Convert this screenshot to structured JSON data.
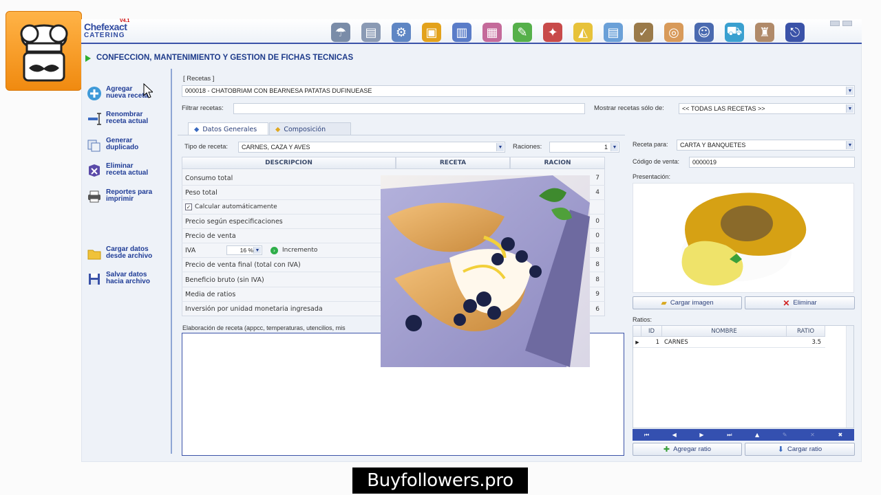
{
  "brand": {
    "line1": "Chefexact",
    "line2": "CATERING",
    "version": "V4.1"
  },
  "toolbar_icons": [
    "umbrella-icon",
    "register-icon",
    "gear-icon",
    "basket-icon",
    "folder-icon",
    "briefcase-icon",
    "pencils-icon",
    "map-icon",
    "cheese-icon",
    "document-icon",
    "checklist-icon",
    "ring-icon",
    "person-icon",
    "truck-icon",
    "bottle-icon",
    "exit-icon"
  ],
  "page_title": "CONFECCION, MANTENIMIENTO Y GESTION DE FICHAS TECNICAS",
  "sidebar": [
    {
      "label": "Agregar\nnueva receta",
      "icon": "add-icon"
    },
    {
      "label": "Renombrar\nreceta actual",
      "icon": "rename-icon"
    },
    {
      "label": "Generar\nduplicado",
      "icon": "duplicate-icon"
    },
    {
      "label": "Eliminar\nreceta actual",
      "icon": "delete-icon"
    },
    {
      "label": "Reportes para\nimprimir",
      "icon": "printer-icon"
    },
    {
      "label": "Cargar datos\ndesde archivo",
      "icon": "folder-open-icon"
    },
    {
      "label": "Salvar datos\nhacia archivo",
      "icon": "save-icon"
    }
  ],
  "recetas": {
    "group_label": "[ Recetas ]",
    "selected": "000018 - CHATOBRIAM CON BEARNESA PATATAS DUFINUEASE",
    "filter_label": "Filtrar recetas:",
    "filter_value": "",
    "show_label": "Mostrar recetas sólo de:",
    "show_value": "<< TODAS LAS RECETAS >>"
  },
  "tabs": [
    {
      "label": "Datos Generales",
      "active": true
    },
    {
      "label": "Composición",
      "active": false
    }
  ],
  "general": {
    "tipo_label": "Tipo de receta:",
    "tipo_value": "CARNES, CAZA Y AVES",
    "raciones_label": "Raciones:",
    "raciones_value": "1",
    "columns": [
      "DESCRIPCION",
      "RECETA",
      "RACION"
    ],
    "rows": [
      {
        "label": "Consumo total",
        "racion": "7"
      },
      {
        "label": "Peso total",
        "racion": "4"
      },
      {
        "label": "Calcular automáticamente",
        "racion": ""
      },
      {
        "label": "Precio según especificaciones",
        "racion": "0"
      },
      {
        "label": "Precio de venta",
        "racion": "0"
      },
      {
        "label": "IVA",
        "racion": "8"
      },
      {
        "label": "Precio de venta final (total con IVA)",
        "racion": "8"
      },
      {
        "label": "Beneficio bruto (sin IVA)",
        "racion": "8"
      },
      {
        "label": "Media de ratios",
        "racion": "9"
      },
      {
        "label": "Inversión por unidad monetaria ingresada",
        "racion": "6"
      }
    ],
    "iva_value": "16 %",
    "iva_increment": "Incremento",
    "elab_label": "Elaboración de receta (appcc, temperaturas, utencilios, mis"
  },
  "right": {
    "receta_para_label": "Receta para:",
    "receta_para_value": "CARTA Y BANQUETES",
    "codigo_label": "Código de venta:",
    "codigo_value": "0000019",
    "presentacion_label": "Presentación:",
    "cargar_imagen": "Cargar imagen",
    "eliminar": "Eliminar",
    "ratios_label": "Ratios:",
    "ratio_columns": [
      "ID",
      "NOMBRE",
      "RATIO"
    ],
    "ratio_rows": [
      {
        "id": "1",
        "nombre": "CARNES",
        "ratio": "3.5"
      }
    ],
    "agregar_ratio": "Agregar ratio",
    "cargar_ratio": "Cargar ratio"
  },
  "watermark": "Buyfollowers.pro",
  "colors": {
    "accent": "#3a52a8",
    "title": "#1d3a8a",
    "logo": "#f08a10"
  }
}
